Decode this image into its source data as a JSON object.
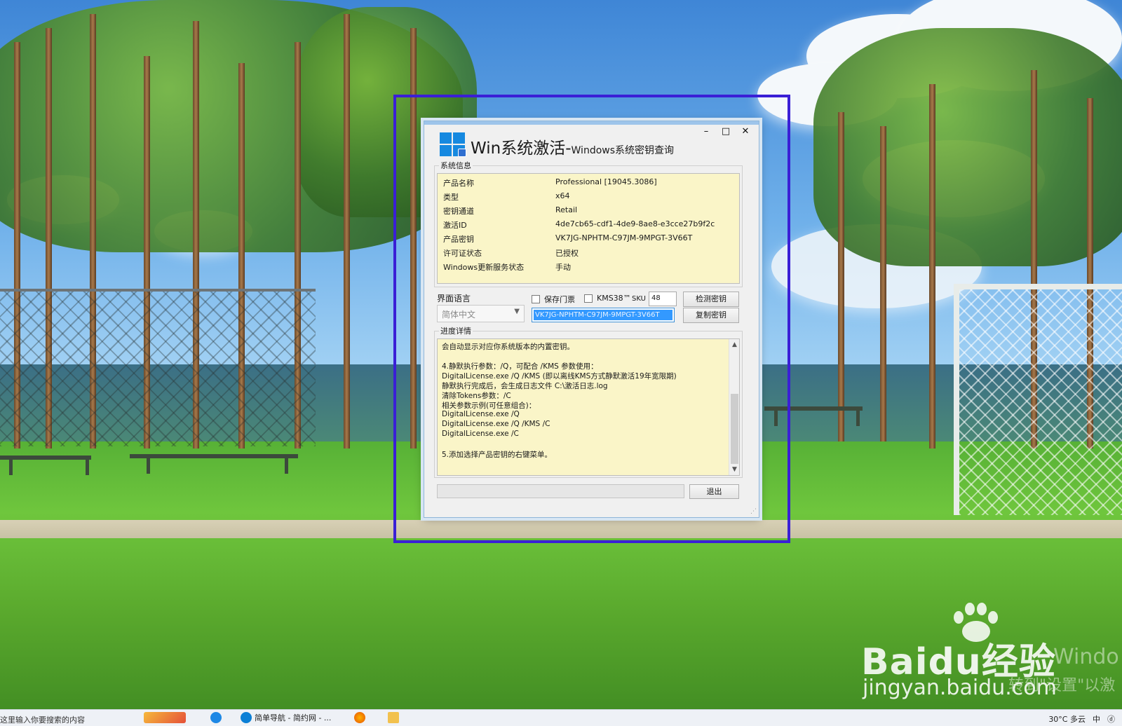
{
  "window": {
    "title_main": "Win系统激活-",
    "title_sub": "Windows系统密钥查询",
    "controls": {
      "minimize": "–",
      "maximize": "□",
      "close": "✕"
    }
  },
  "system_info": {
    "group_label": "系统信息",
    "rows": [
      {
        "label": "产品名称",
        "value": "Professional [19045.3086]"
      },
      {
        "label": "类型",
        "value": "x64"
      },
      {
        "label": "密钥通道",
        "value": "Retail"
      },
      {
        "label": "激活ID",
        "value": "4de7cb65-cdf1-4de9-8ae8-e3cce27b9f2c"
      },
      {
        "label": "产品密钥",
        "value": "VK7JG-NPHTM-C97JM-9MPGT-3V66T"
      },
      {
        "label": "许可证状态",
        "value": "已授权"
      },
      {
        "label": "Windows更新服务状态",
        "value": "手动"
      }
    ]
  },
  "options": {
    "language_label": "界面语言",
    "language_value": "简体中文",
    "save_ticket_label": "保存门票",
    "kms38_label": "KMS38™",
    "sku_label": "SKU",
    "sku_value": "48",
    "detect_key_button": "检测密钥",
    "copy_key_button": "复制密钥",
    "key_field_value": "VK7JG-NPHTM-C97JM-9MPGT-3V66T"
  },
  "progress": {
    "group_label": "进度详情",
    "log_lines": [
      "会自动显示对应你系统版本的内置密钥。",
      "",
      "4.静默执行参数：/Q，可配合 /KMS 参数使用：",
      "DigitalLicense.exe /Q /KMS (即以离线KMS方式静默激活19年宽限期)",
      "静默执行完成后，会生成日志文件 C:\\激活日志.log",
      "清除Tokens参数：/C",
      "相关参数示例(可任意组合)：",
      "DigitalLicense.exe /Q",
      "DigitalLicense.exe /Q /KMS /C",
      "DigitalLicense.exe /C",
      "",
      "5.添加选择产品密钥的右键菜单。"
    ],
    "exit_button": "退出"
  },
  "watermark": {
    "brand": "Bai",
    "brand_du": "du",
    "brand_cn": "经验",
    "url": "jingyan.baidu.com",
    "faint_text_1": "Windo",
    "faint_text_2": "转到\"设置\"以激"
  },
  "taskbar": {
    "search_text": "这里输入你要搜索的内容",
    "items": [
      {
        "label": "简单导航 - 简约网 - ..."
      }
    ],
    "tray": {
      "weather": "30°C 多云",
      "ime": "中",
      "volume": "ⓓ"
    }
  },
  "colors": {
    "highlight": "#3a1fd6",
    "info_bg": "#faf5c8",
    "selection": "#3399ff"
  }
}
